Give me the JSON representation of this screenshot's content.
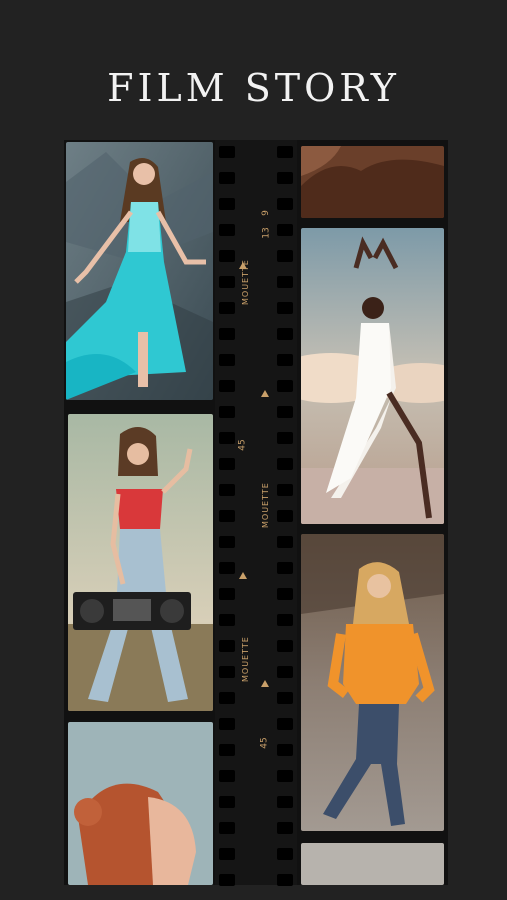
{
  "title": "FILM STORY",
  "strip_labels": {
    "brand": "MOUETTE",
    "numbers": [
      "9",
      "13",
      "45",
      "45"
    ]
  },
  "colors": {
    "background": "#232323",
    "film": "#111111",
    "accent": "#c9a06a"
  },
  "photos": [
    "woman-in-turquoise-sequin-gown",
    "woman-in-red-top-holding-boombox",
    "woman-with-red-hair-profile",
    "brown-draped-fabric",
    "dancer-in-white-dress-at-sea",
    "woman-in-orange-hoodie"
  ]
}
